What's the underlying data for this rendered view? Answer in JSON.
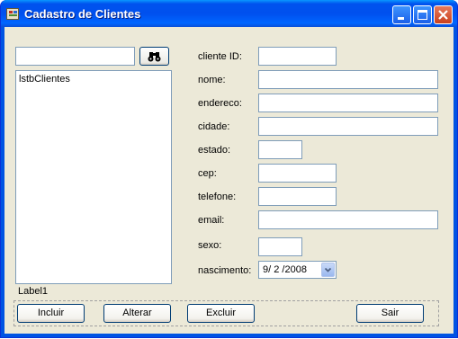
{
  "window": {
    "title": "Cadastro de Clientes"
  },
  "search": {
    "value": ""
  },
  "list": {
    "items": [
      "lstbClientes"
    ]
  },
  "status_label": "Label1",
  "form": {
    "fields": [
      {
        "label": "cliente ID:",
        "value": ""
      },
      {
        "label": "nome:",
        "value": ""
      },
      {
        "label": "endereco:",
        "value": ""
      },
      {
        "label": "cidade:",
        "value": ""
      },
      {
        "label": "estado:",
        "value": ""
      },
      {
        "label": "cep:",
        "value": ""
      },
      {
        "label": "telefone:",
        "value": ""
      },
      {
        "label": "email:",
        "value": ""
      },
      {
        "label": "sexo:",
        "value": ""
      }
    ],
    "nascimento": {
      "label": "nascimento:",
      "value": "9/ 2 /2008"
    }
  },
  "buttons": {
    "incluir": "Incluir",
    "alterar": "Alterar",
    "excluir": "Excluir",
    "sair": "Sair"
  },
  "icons": {
    "search": "binoculars-icon",
    "app": "form-app-icon",
    "minimize": "minimize-icon",
    "maximize": "maximize-icon",
    "close": "close-icon",
    "dropdown": "chevron-down-icon"
  },
  "colors": {
    "titlebar": "#0054e3",
    "client_bg": "#ece9d8",
    "close_button": "#e04a2a"
  }
}
